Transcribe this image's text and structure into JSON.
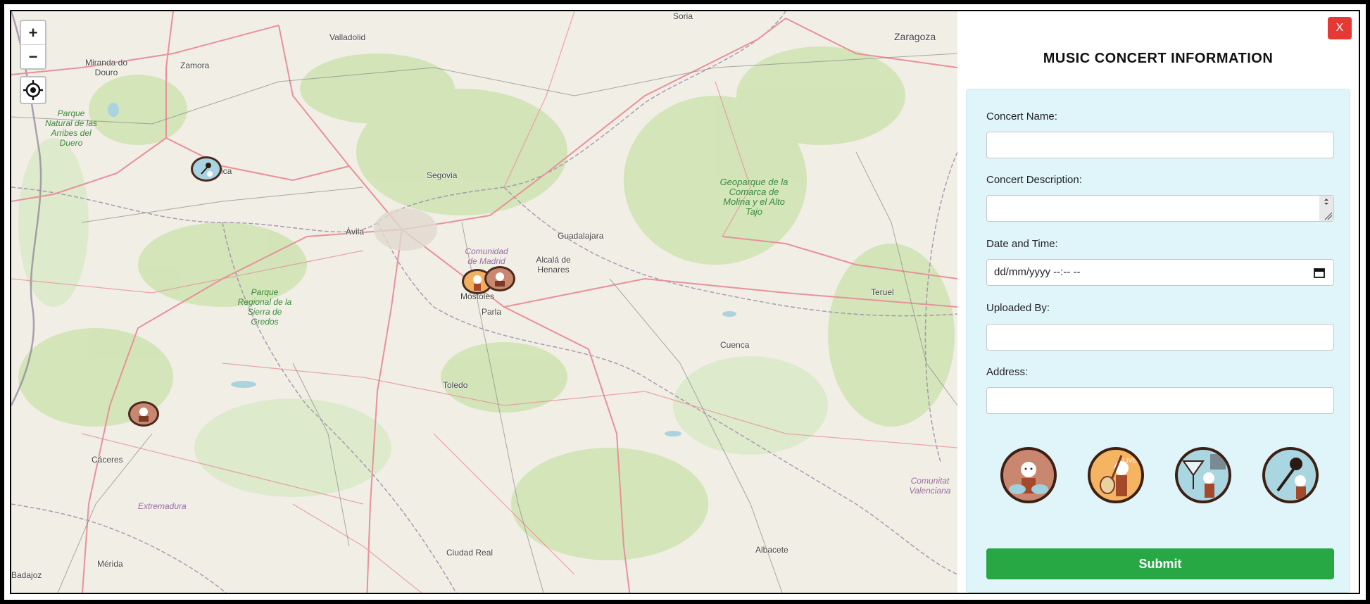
{
  "map": {
    "zoom_in_label": "+",
    "zoom_out_label": "−",
    "locate_icon": "crosshair-icon",
    "cities": [
      "Valladolid",
      "Zaragoza",
      "Miranda do Douro",
      "Zamora",
      "Segovia",
      "Ávila",
      "Guadalajara",
      "Alcalá de Henares",
      "Móstoles",
      "Parla",
      "Toledo",
      "Cuenca",
      "Teruel",
      "Cáceres",
      "Mérida",
      "Ciudad Real",
      "Albacete",
      "Soria",
      "Badajoz"
    ],
    "parks": [
      "Parque Natural de las Arribes del Duero",
      "Parque Regional de la Sierra de Gredos",
      "Geoparque de la Comarca de Molina y el Alto Tajo"
    ],
    "regions": [
      "Comunidad de Madrid",
      "Extremadura",
      "Comunitat Valenciana"
    ],
    "partial_labels": [
      "ica"
    ]
  },
  "panel": {
    "close_label": "X",
    "title": "MUSIC CONCERT INFORMATION",
    "fields": {
      "name_label": "Concert Name:",
      "description_label": "Concert Description:",
      "datetime_label": "Date and Time:",
      "datetime_value": "dd/mm/yyyy --:-- --",
      "uploaded_label": "Uploaded By:",
      "address_label": "Address:"
    },
    "icons": [
      "drummer-icon",
      "guitar-live-icon",
      "cocktail-singer-icon",
      "microphone-singer-icon"
    ],
    "submit_label": "Submit"
  },
  "colors": {
    "submit": "#28a745",
    "close": "#e53935",
    "form_bg": "#e0f5f9"
  }
}
